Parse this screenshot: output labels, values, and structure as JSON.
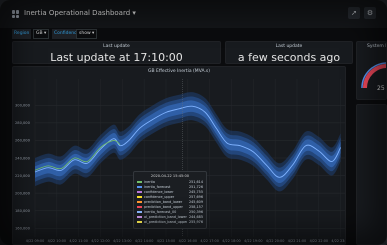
{
  "header": {
    "title": "Inertia Operational Dashboard",
    "caret": "▾",
    "share_icon": "share-icon",
    "settings_icon": "gear-icon"
  },
  "variables": {
    "region_label": "Region",
    "region_value": "GB ▾",
    "confidence_label": "Confidence",
    "confidence_value": "show ▾"
  },
  "panels": {
    "last_update_1": {
      "title": "Last update",
      "value": "Last update at  17:10:00"
    },
    "last_update_2": {
      "title": "Last update",
      "value": "a few seconds ago"
    },
    "system_panel": {
      "title": "System In"
    },
    "gauge_value": "25"
  },
  "chart": {
    "title": "GB Effective Inertia (MVA.s)"
  },
  "chart_data": {
    "type": "line",
    "title": "GB Effective Inertia (MVA.s)",
    "xlabel": "",
    "ylabel": "",
    "ylim": [
      150000,
      330000
    ],
    "y_ticks": [
      {
        "value": 300000,
        "label": "300,000"
      },
      {
        "value": 280000,
        "label": "280,000"
      },
      {
        "value": 260000,
        "label": "260,000"
      },
      {
        "value": 240000,
        "label": "240,000"
      },
      {
        "value": 220000,
        "label": "220,000"
      },
      {
        "value": 200000,
        "label": "200,000"
      },
      {
        "value": 180000,
        "label": "180,000"
      },
      {
        "value": 160000,
        "label": "160,000"
      }
    ],
    "x_ticks": [
      "4/22 09:00",
      "4/22 10:00",
      "4/22 11:00",
      "4/22 12:00",
      "4/22 13:00",
      "4/22 14:00",
      "4/22 15:00",
      "4/22 16:00",
      "4/22 17:00",
      "4/22 18:00",
      "4/22 19:00",
      "4/22 20:00",
      "4/22 21:00",
      "4/22 22:00",
      "4/22 23:00"
    ],
    "x": [
      0,
      0.6,
      1.2,
      1.8,
      2.4,
      3.0,
      3.6,
      3.9,
      4.3,
      4.8,
      5.4,
      6.0,
      6.6,
      7.2,
      7.8,
      8.3,
      8.8,
      9.4,
      10.0,
      10.6,
      11.2,
      11.8,
      12.4,
      13.0,
      13.6,
      14.0
    ],
    "series": [
      {
        "name": "inertia_forecast",
        "values": [
          224000,
          229000,
          226000,
          238000,
          234000,
          250000,
          262000,
          254000,
          260000,
          274000,
          284000,
          292000,
          296000,
          299000,
          292000,
          274000,
          257000,
          254000,
          247000,
          232000,
          218000,
          232000,
          254000,
          248000,
          236000,
          252000
        ]
      }
    ],
    "band_halfwidth": 5000,
    "actual_inertia_x": [
      0,
      0.6,
      1.2,
      1.8,
      2.4,
      3.0,
      3.6,
      3.9
    ],
    "actual_inertia_values": [
      226000,
      231000,
      228000,
      240000,
      236000,
      252000,
      260000,
      255000
    ],
    "grid": true
  },
  "tooltip": {
    "title": "2020-04-22 15:45:00",
    "rows": [
      {
        "name": "inertia",
        "value": "251,614",
        "color": "#73bf69"
      },
      {
        "name": "inertia_forecast",
        "value": "251,726",
        "color": "#5794f2"
      },
      {
        "name": "confidence_lower",
        "value": "245,755",
        "color": "#b877d9"
      },
      {
        "name": "confidence_upper",
        "value": "257,696",
        "color": "#fade2a"
      },
      {
        "name": "prediction_band_lower",
        "value": "245,609",
        "color": "#ff9830"
      },
      {
        "name": "prediction_band_upper",
        "value": "258,157",
        "color": "#f2495c"
      },
      {
        "name": "inertia_forecast_00",
        "value": "250,396",
        "color": "#8ab8ff"
      },
      {
        "name": "ol_prediction_band_lower",
        "value": "244,685",
        "color": "#ca95e5"
      },
      {
        "name": "ol_prediction_band_upper",
        "value": "255,976",
        "color": "#ffee52"
      }
    ]
  },
  "colors": {
    "background": "#0b0c0e",
    "panel": "#181b1f",
    "series": "#5794f2",
    "actual": "#73bf69",
    "gauge": "#f2495c"
  }
}
